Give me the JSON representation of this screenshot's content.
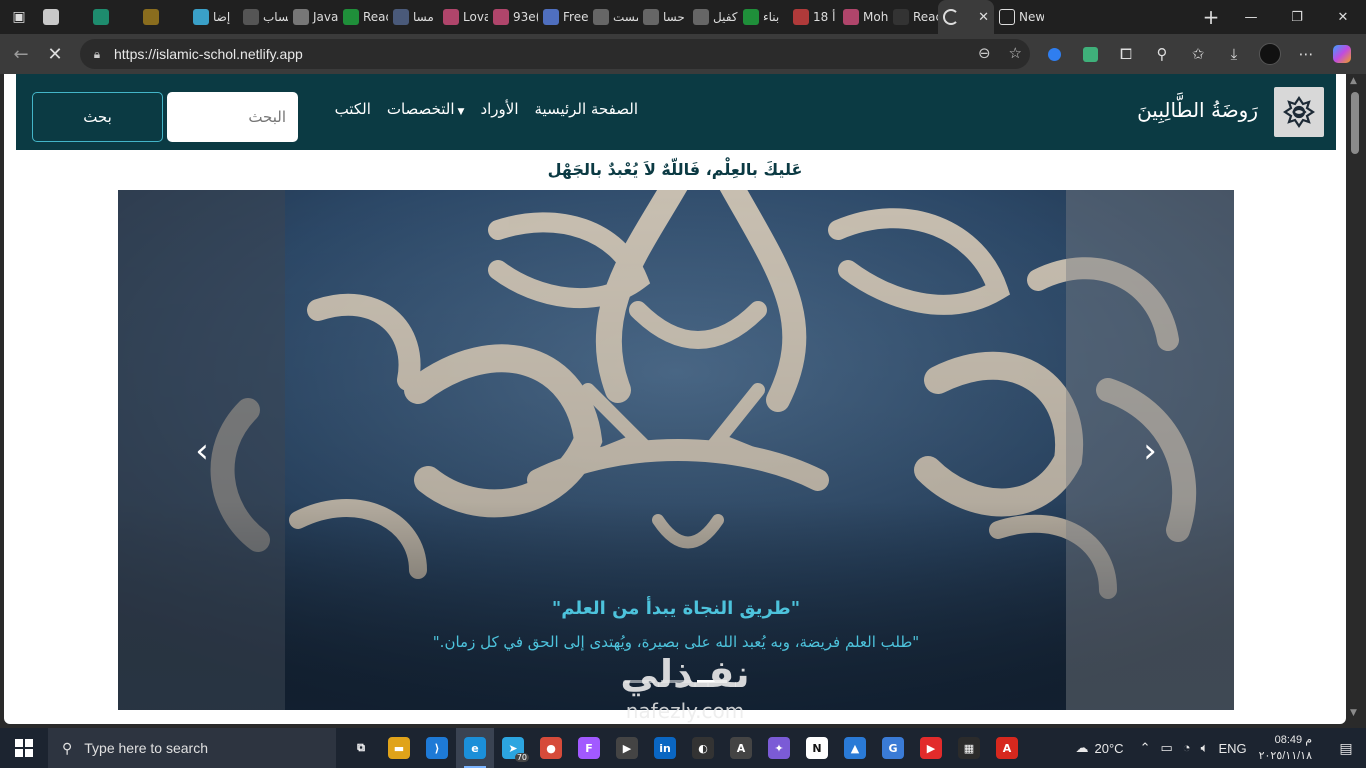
{
  "browser": {
    "tabs": [
      {
        "label": "",
        "color": "#c9c9c9",
        "icon": "github-icon"
      },
      {
        "label": "",
        "color": "#1e8c6e",
        "icon": "diamond-icon"
      },
      {
        "label": "",
        "color": "#8a6d1e",
        "icon": "s-icon"
      },
      {
        "label": "إضا",
        "color": "#3aa0c8",
        "icon": "circle-icon"
      },
      {
        "label": "حساب",
        "color": "#555555",
        "icon": "doc-icon"
      },
      {
        "label": "Java",
        "color": "#777777",
        "icon": "m-icon"
      },
      {
        "label": "Read",
        "color": "#1f8f3a",
        "icon": "w-icon"
      },
      {
        "label": "مسا",
        "color": "#4a5a7a",
        "icon": "e-icon"
      },
      {
        "label": "Lova",
        "color": "#b0456b",
        "icon": "heart-icon"
      },
      {
        "label": "93e(",
        "color": "#b0456b",
        "icon": "heart-icon"
      },
      {
        "label": "Free",
        "color": "#4f6fbf",
        "icon": "doc-icon"
      },
      {
        "label": "مست",
        "color": "#666666",
        "icon": "search-icon"
      },
      {
        "label": "حسا",
        "color": "#666666",
        "icon": "search-icon"
      },
      {
        "label": "كفيل",
        "color": "#666666",
        "icon": "search-icon"
      },
      {
        "label": "بناء",
        "color": "#1f8f3a",
        "icon": "k-icon"
      },
      {
        "label": "18 أ",
        "color": "#b03a3a",
        "icon": "person-icon"
      },
      {
        "label": "Moh",
        "color": "#b0456b",
        "icon": "heart-icon"
      },
      {
        "label": "Reac",
        "color": "#333333",
        "icon": "dot-icon"
      }
    ],
    "active_tab": {
      "label": "",
      "close": "✕"
    },
    "next_tab": {
      "label": "New"
    },
    "url": "https://islamic-schol.netlify.app",
    "window_controls": {
      "minimize": "—",
      "maximize": "❐",
      "close": "✕"
    }
  },
  "site": {
    "brand": "رَوضَةُ الطَّالِبِينَ",
    "nav": {
      "home": "الصفحة الرئيسية",
      "awrad": "الأوراد",
      "specialties": "التخصصات",
      "books": "الكتب"
    },
    "search": {
      "placeholder": "البحث",
      "button": "بحث"
    },
    "motto": "عَليكَ بالعِلْم، فَاللّهٌ لاَ يُعْبدٌ بالجَهْل",
    "carousel": {
      "title": "\"طريق النجاة يبدأ من العلم\"",
      "text": "\"طلب العلم فريضة، وبه يُعبد الله على بصيرة، ويُهتدى إلى الحق في كل زمان.\"",
      "prev": "‹",
      "next": "›",
      "indicators": 3,
      "active_indicator": 3
    }
  },
  "watermark": {
    "arabic": "نفـذلي",
    "latin": "nafezly.com"
  },
  "taskbar": {
    "search_placeholder": "Type here to search",
    "apps": [
      {
        "name": "task-view",
        "color": "#1c2430",
        "glyph": "⧉"
      },
      {
        "name": "file-explorer",
        "color": "#e0a31a",
        "glyph": "▬"
      },
      {
        "name": "vscode",
        "color": "#1e7ad6",
        "glyph": "⟩"
      },
      {
        "name": "edge",
        "color": "#1b8fd8",
        "glyph": "e"
      },
      {
        "name": "telegram",
        "color": "#2ca5e0",
        "glyph": "➤"
      },
      {
        "name": "chrome",
        "color": "#d64b3a",
        "glyph": "●"
      },
      {
        "name": "figma",
        "color": "#a259ff",
        "glyph": "F"
      },
      {
        "name": "media",
        "color": "#444444",
        "glyph": "▶"
      },
      {
        "name": "linkedin",
        "color": "#0a66c2",
        "glyph": "in"
      },
      {
        "name": "github-desktop",
        "color": "#333333",
        "glyph": "◐"
      },
      {
        "name": "font",
        "color": "#444444",
        "glyph": "A"
      },
      {
        "name": "vs",
        "color": "#7b5bd6",
        "glyph": "✦"
      },
      {
        "name": "notion",
        "color": "#ffffff",
        "glyph": "N"
      },
      {
        "name": "photos",
        "color": "#2a7ad6",
        "glyph": "▲"
      },
      {
        "name": "translate",
        "color": "#3a7bd6",
        "glyph": "G"
      },
      {
        "name": "youtube",
        "color": "#e22b2b",
        "glyph": "▶"
      },
      {
        "name": "spreadsheet",
        "color": "#2b2b2b",
        "glyph": "▦"
      },
      {
        "name": "pdf",
        "color": "#d6281e",
        "glyph": "A"
      }
    ],
    "telegram_badge": "70",
    "weather": {
      "temp": "20°C"
    },
    "language": "ENG",
    "time": "08:49 م",
    "date": "٢٠٢٥/١١/١٨"
  }
}
